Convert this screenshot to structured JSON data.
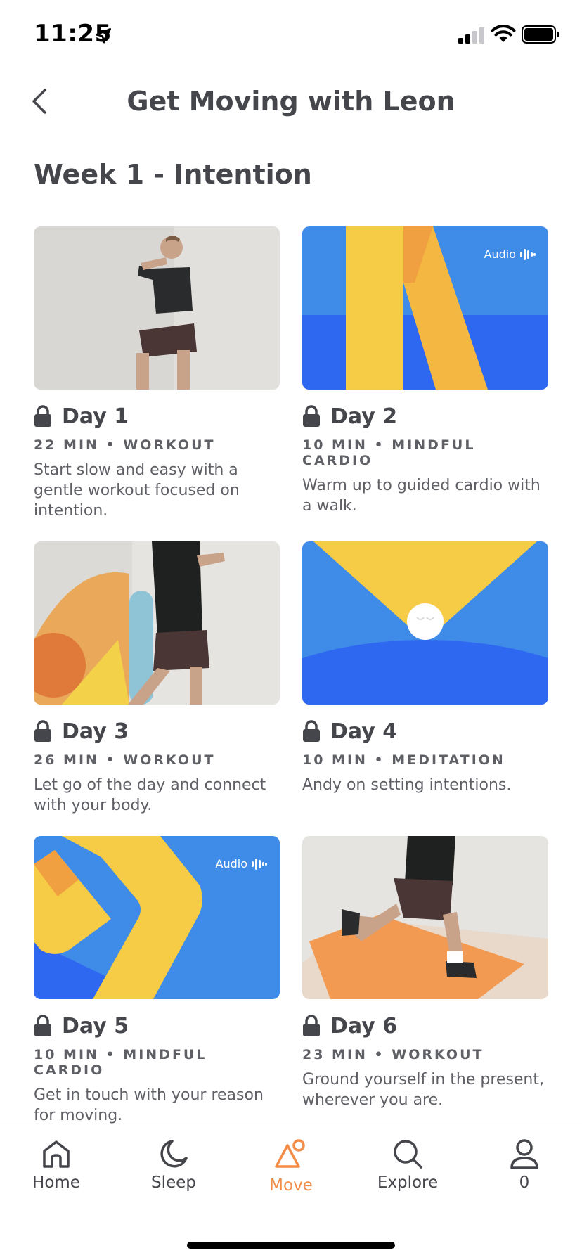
{
  "status_bar": {
    "time": "11:25"
  },
  "header": {
    "title": "Get Moving with Leon"
  },
  "section": {
    "heading": "Week 1 - Intention"
  },
  "cards": [
    {
      "day": "Day 1",
      "meta": "22 MIN • WORKOUT",
      "desc": "Start slow and easy with a gentle workout focused on intention.",
      "thumb": "man-wall-sit-photo"
    },
    {
      "day": "Day 2",
      "meta": "10 MIN • MINDFUL CARDIO",
      "desc": "Warm up to guided cardio with a walk.",
      "thumb": "abstract-yellow-blue",
      "audio_label": "Audio"
    },
    {
      "day": "Day 3",
      "meta": "26 MIN • WORKOUT",
      "desc": "Let go of the day and connect with your body.",
      "thumb": "man-wall-stretch-photo"
    },
    {
      "day": "Day 4",
      "meta": "10 MIN • MEDITATION",
      "desc": "Andy on setting intentions.",
      "thumb": "abstract-headspace-ball"
    },
    {
      "day": "Day 5",
      "meta": "10 MIN • MINDFUL CARDIO",
      "desc": "Get in touch with your reason for moving.",
      "thumb": "abstract-yellow-chevron",
      "audio_label": "Audio"
    },
    {
      "day": "Day 6",
      "meta": "23 MIN • WORKOUT",
      "desc": "Ground yourself in the present, wherever you are.",
      "thumb": "man-lunge-mat-photo"
    }
  ],
  "tabs": [
    {
      "label": "Home",
      "icon": "home-icon"
    },
    {
      "label": "Sleep",
      "icon": "moon-icon"
    },
    {
      "label": "Move",
      "icon": "move-icon",
      "active": true
    },
    {
      "label": "Explore",
      "icon": "search-icon"
    },
    {
      "label": "0",
      "icon": "profile-icon"
    }
  ],
  "colors": {
    "accent": "#f28c47",
    "text": "#45464b",
    "blue": "#3f8ce8",
    "deep_blue": "#2f68f0",
    "yellow": "#f6cb45",
    "orange": "#f0a040"
  }
}
